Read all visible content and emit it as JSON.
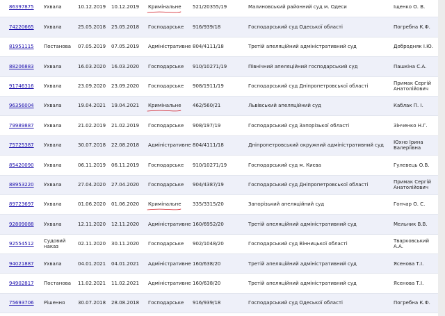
{
  "colors": {
    "link": "#1a0dab",
    "row_alt": "#eef0f9",
    "annotation": "#d0101b"
  },
  "rows": [
    {
      "id": "86397875",
      "type": "Ухвала",
      "reg_date": "10.12.2019",
      "law_date": "10.12.2019",
      "form": "Кримінальне",
      "case": "521/20355/19",
      "court": "Малиновський районний суд м. Одеси",
      "judge": "Іщенко О. В.",
      "marked": true
    },
    {
      "id": "74220665",
      "type": "Ухвала",
      "reg_date": "25.05.2018",
      "law_date": "25.05.2018",
      "form": "Господарське",
      "case": "916/939/18",
      "court": "Господарський суд Одеської області",
      "judge": "Погребна К.Ф.",
      "marked": false
    },
    {
      "id": "81951115",
      "type": "Постанова",
      "reg_date": "07.05.2019",
      "law_date": "07.05.2019",
      "form": "Адміністративне",
      "case": "804/4111/18",
      "court": "Третій апеляційний адміністративний суд",
      "judge": "Добродняк І.Ю.",
      "marked": false
    },
    {
      "id": "88206883",
      "type": "Ухвала",
      "reg_date": "16.03.2020",
      "law_date": "16.03.2020",
      "form": "Господарське",
      "case": "910/10271/19",
      "court": "Північний апеляційний господарський суд",
      "judge": "Пашкіна С.А.",
      "marked": false
    },
    {
      "id": "91746316",
      "type": "Ухвала",
      "reg_date": "23.09.2020",
      "law_date": "23.09.2020",
      "form": "Господарське",
      "case": "908/1911/19",
      "court": "Господарський суд Дніпропетровської області",
      "judge": "Примак Сергій Анатолійович",
      "marked": false
    },
    {
      "id": "96356004",
      "type": "Ухвала",
      "reg_date": "19.04.2021",
      "law_date": "19.04.2021",
      "form": "Кримінальне",
      "case": "462/560/21",
      "court": "Львівський апеляційний суд",
      "judge": "Каблак П. І.",
      "marked": true
    },
    {
      "id": "79989887",
      "type": "Ухвала",
      "reg_date": "21.02.2019",
      "law_date": "21.02.2019",
      "form": "Господарське",
      "case": "908/197/19",
      "court": "Господарський суд Запорізької області",
      "judge": "Зінченко Н.Г.",
      "marked": false
    },
    {
      "id": "75725387",
      "type": "Ухвала",
      "reg_date": "30.07.2018",
      "law_date": "22.08.2018",
      "form": "Адміністративне",
      "case": "804/4111/18",
      "court": "Дніпропетровський окружний адміністративний суд",
      "judge": "Юхно Ірина Валеріївна",
      "marked": false
    },
    {
      "id": "85420090",
      "type": "Ухвала",
      "reg_date": "06.11.2019",
      "law_date": "06.11.2019",
      "form": "Господарське",
      "case": "910/10271/19",
      "court": "Господарський суд м. Києва",
      "judge": "Гулевець О.В.",
      "marked": false
    },
    {
      "id": "88953220",
      "type": "Ухвала",
      "reg_date": "27.04.2020",
      "law_date": "27.04.2020",
      "form": "Господарське",
      "case": "904/4387/19",
      "court": "Господарський суд Дніпропетровської області",
      "judge": "Примак Сергій Анатолійович",
      "marked": false
    },
    {
      "id": "89723697",
      "type": "Ухвала",
      "reg_date": "01.06.2020",
      "law_date": "01.06.2020",
      "form": "Кримінальне",
      "case": "335/3315/20",
      "court": "Запорізький апеляційний суд",
      "judge": "Гончар О. С.",
      "marked": true
    },
    {
      "id": "92809088",
      "type": "Ухвала",
      "reg_date": "12.11.2020",
      "law_date": "12.11.2020",
      "form": "Адміністративне",
      "case": "160/6952/20",
      "court": "Третій апеляційний адміністративний суд",
      "judge": "Мельник В.В.",
      "marked": false
    },
    {
      "id": "92554512",
      "type": "Судовий наказ",
      "reg_date": "02.11.2020",
      "law_date": "30.11.2020",
      "form": "Господарське",
      "case": "902/1048/20",
      "court": "Господарський суд Вінницької області",
      "judge": "Тварковський А.А.",
      "marked": false
    },
    {
      "id": "94021887",
      "type": "Ухвала",
      "reg_date": "04.01.2021",
      "law_date": "04.01.2021",
      "form": "Адміністративне",
      "case": "160/638/20",
      "court": "Третій апеляційний адміністративний суд",
      "judge": "Ясенова Т.І.",
      "marked": false
    },
    {
      "id": "94902817",
      "type": "Постанова",
      "reg_date": "11.02.2021",
      "law_date": "11.02.2021",
      "form": "Адміністративне",
      "case": "160/638/20",
      "court": "Третій апеляційний адміністративний суд",
      "judge": "Ясенова Т.І.",
      "marked": false
    },
    {
      "id": "75693706",
      "type": "Рішення",
      "reg_date": "30.07.2018",
      "law_date": "28.08.2018",
      "form": "Господарське",
      "case": "916/939/18",
      "court": "Господарський суд Одеської області",
      "judge": "Погребна К.Ф.",
      "marked": false
    }
  ]
}
